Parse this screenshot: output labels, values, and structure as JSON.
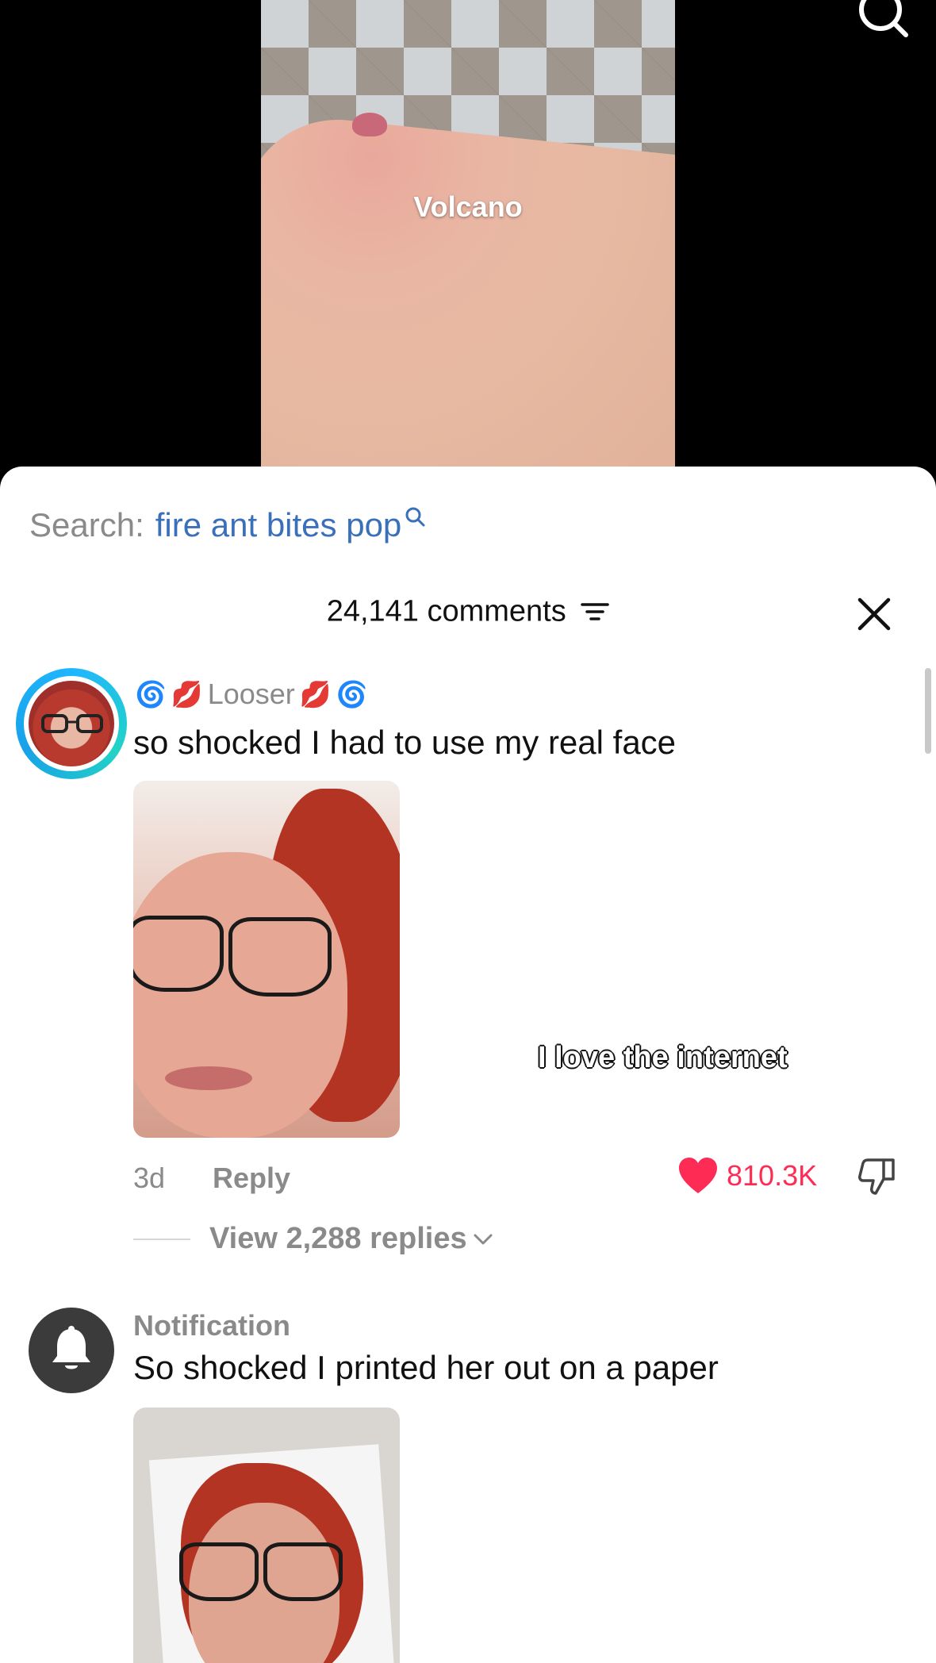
{
  "video": {
    "caption": "Volcano",
    "search_icon": "search-icon"
  },
  "search": {
    "prefix": "Search:",
    "query": "fire ant bites pop"
  },
  "comments_header": {
    "count_label": "24,141 comments",
    "filter_icon": "filter-icon",
    "close_icon": "close-icon"
  },
  "comments": [
    {
      "username": "Looser",
      "emojis_before": [
        "🌀",
        "💋"
      ],
      "emojis_after": [
        "💋",
        "🌀"
      ],
      "text": "so shocked I had to use my real face",
      "sticker_text": "I love the internet",
      "time": "3d",
      "reply_label": "Reply",
      "like_count": "810.3K",
      "view_replies": "View 2,288 replies"
    },
    {
      "username": "Notification",
      "text": "So shocked I printed her out on a paper"
    }
  ],
  "colors": {
    "accent_like": "#fe2c55",
    "search_query": "#3a6fb9",
    "muted_text": "#8a8a8a"
  }
}
